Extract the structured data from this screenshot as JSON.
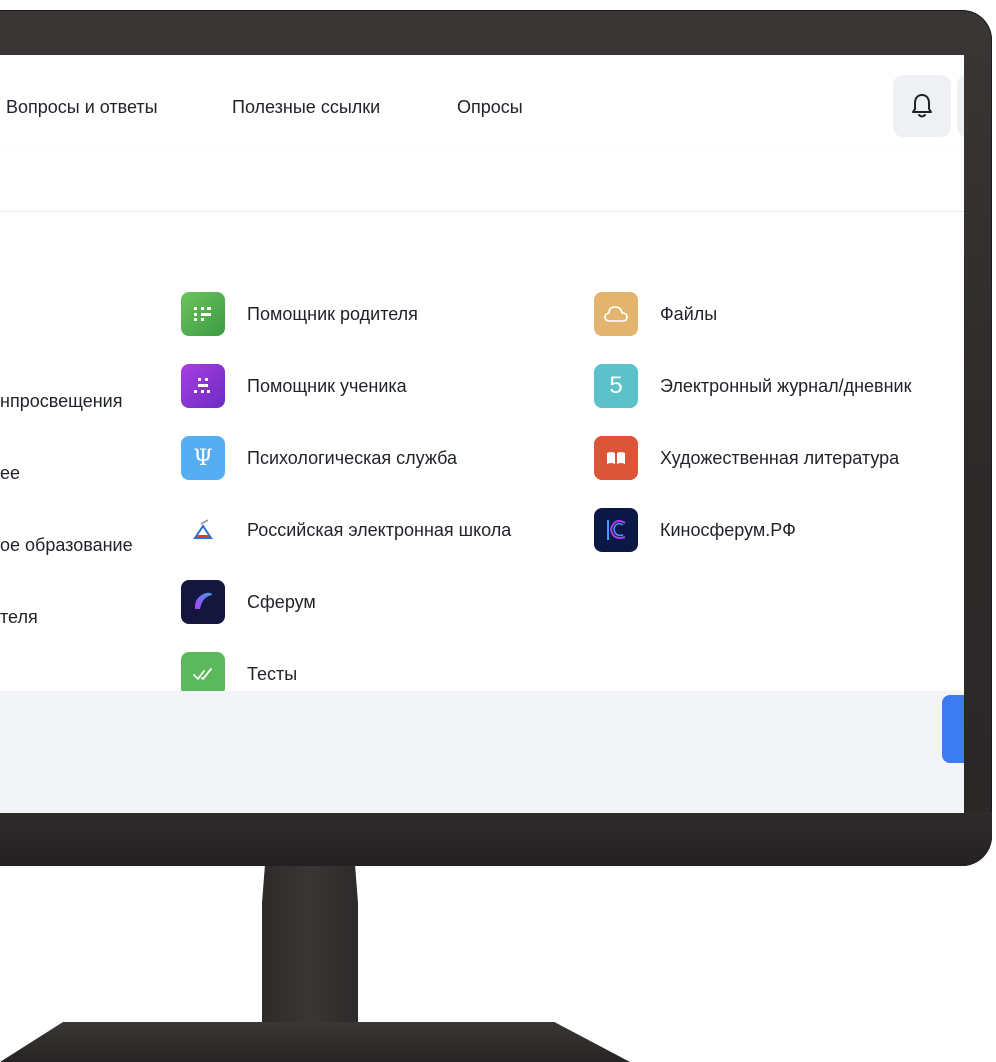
{
  "header": {
    "nav": [
      "Вопросы и ответы",
      "Полезные ссылки",
      "Опросы"
    ]
  },
  "left_column_partial": [
    "нпросвещения",
    "ее",
    "ое образование",
    "теля"
  ],
  "middle_column": [
    {
      "label": "Помощник родителя",
      "icon": "parent-helper-icon",
      "color": "#4caf50"
    },
    {
      "label": "Помощник ученика",
      "icon": "student-helper-icon",
      "color": "#8e3bd6"
    },
    {
      "label": "Психологическая служба",
      "icon": "psychology-icon",
      "color": "#4aa8f0"
    },
    {
      "label": "Российская электронная школа",
      "icon": "res-logo-icon",
      "color": "#ffffff"
    },
    {
      "label": "Сферум",
      "icon": "sferum-icon",
      "color": "#1b1f4a"
    },
    {
      "label": "Тесты",
      "icon": "tests-icon",
      "color": "#5cb85c"
    }
  ],
  "right_column": [
    {
      "label": "Файлы",
      "icon": "cloud-files-icon",
      "color": "#e0b06a"
    },
    {
      "label": "Электронный журнал/дневник",
      "icon": "journal-5-icon",
      "color": "#5bbfc7",
      "glyph": "5"
    },
    {
      "label": "Художественная литература",
      "icon": "book-icon",
      "color": "#d9533a"
    },
    {
      "label": "Киносферум.РФ",
      "icon": "kinosferum-icon",
      "color": "#0d1a4a"
    }
  ]
}
